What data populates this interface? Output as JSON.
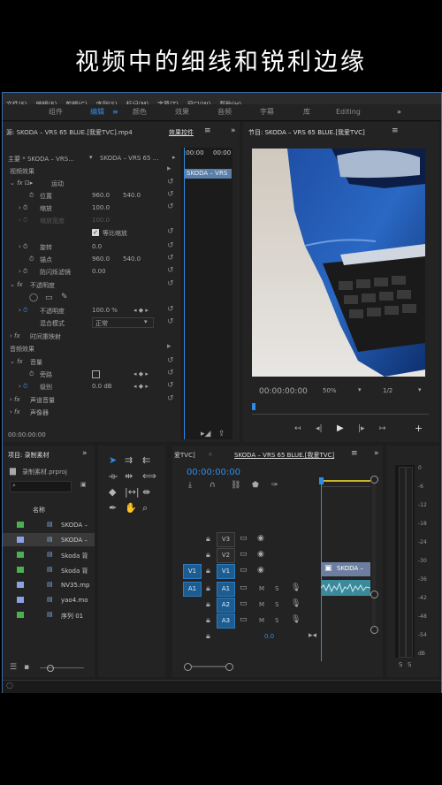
{
  "overlay_title": "视频中的细线和锐利边缘",
  "menu": [
    "文件(F)",
    "编辑(E)",
    "剪辑(C)",
    "序列(S)",
    "标记(M)",
    "字幕(T)",
    "窗口(W)",
    "帮助(H)"
  ],
  "workspaces": [
    "组件",
    "编辑",
    "颜色",
    "效果",
    "音频",
    "字幕",
    "库",
    "Editing"
  ],
  "active_workspace": "编辑",
  "more_glyph": "»",
  "source_tab": "源: SKODA – VRS 65 BLUE.[我爱TVC].mp4",
  "effect_controls_tab": "效果控件",
  "effects": {
    "master_left": "主要 * SKODA – VRS...",
    "master_right": "SKODA – VRS 65 ...",
    "video_effects": "视频效果",
    "motion": "运动",
    "position": "位置",
    "position_x": "960.0",
    "position_y": "540.0",
    "scale": "缩放",
    "scale_val": "100.0",
    "scale_width": "缩放宽度",
    "scale_width_val": "100.0",
    "uniform_scale": "等比缩放",
    "rotation": "旋转",
    "rotation_val": "0.0",
    "anchor": "锚点",
    "anchor_x": "960.0",
    "anchor_y": "540.0",
    "antiflicker": "防闪烁滤镜",
    "antiflicker_val": "0.00",
    "opacity_group": "不透明度",
    "opacity": "不透明度",
    "opacity_val": "100.0 %",
    "blend_mode": "混合模式",
    "blend_mode_val": "正常",
    "time_remap": "时间重映射",
    "audio_effects": "音频效果",
    "volume": "音量",
    "bypass": "旁路",
    "level": "级别",
    "level_val": "0.0 dB",
    "channel_volume": "声道音量",
    "panner": "声像器",
    "timecode": "00:00:00:00",
    "mini_clip": "SKODA – VRS",
    "mini_time_1": ":00:00",
    "mini_time_2": "00:00"
  },
  "program": {
    "tab": "节目: SKODA – VRS 65 BLUE.[我爱TVC]",
    "timecode": "00:00:00:00",
    "zoom": "50%",
    "resolution": "1/2"
  },
  "project": {
    "tab": "项目: 录制素材",
    "file": "录制素材.prproj",
    "col_name": "名称",
    "items": [
      {
        "name": "SKODA –",
        "color": "#4caf50"
      },
      {
        "name": "SKODA –",
        "color": "#8da0e6"
      },
      {
        "name": "Skoda 背",
        "color": "#4caf50"
      },
      {
        "name": "Skoda 背",
        "color": "#4caf50"
      },
      {
        "name": "NV35.mp",
        "color": "#8da0e6"
      },
      {
        "name": "yao4.mo",
        "color": "#8da0e6"
      },
      {
        "name": "序列 01",
        "color": "#4caf50"
      }
    ]
  },
  "timeline": {
    "tab_left": "爱TVC]",
    "tab": "SKODA – VRS 65 BLUE.[我爱TVC]",
    "timecode": "00:00:00:00",
    "tracks_video": [
      "V3",
      "V2",
      "V1"
    ],
    "tracks_audio": [
      "A1",
      "A2",
      "A3"
    ],
    "source_v": "V1",
    "source_a": "A1",
    "master_val": "0.0",
    "clip_name": "SKODA –",
    "mute": "M",
    "solo": "S"
  },
  "meter": {
    "labels": [
      "0",
      "-6",
      "-12",
      "-18",
      "-24",
      "-30",
      "-36",
      "-42",
      "-48",
      "-54",
      "dB"
    ],
    "solo": [
      "S",
      "S"
    ]
  },
  "colors": {
    "accent": "#2d8ceb",
    "panel": "#232323",
    "audio_clip": "#3b8a9c"
  }
}
